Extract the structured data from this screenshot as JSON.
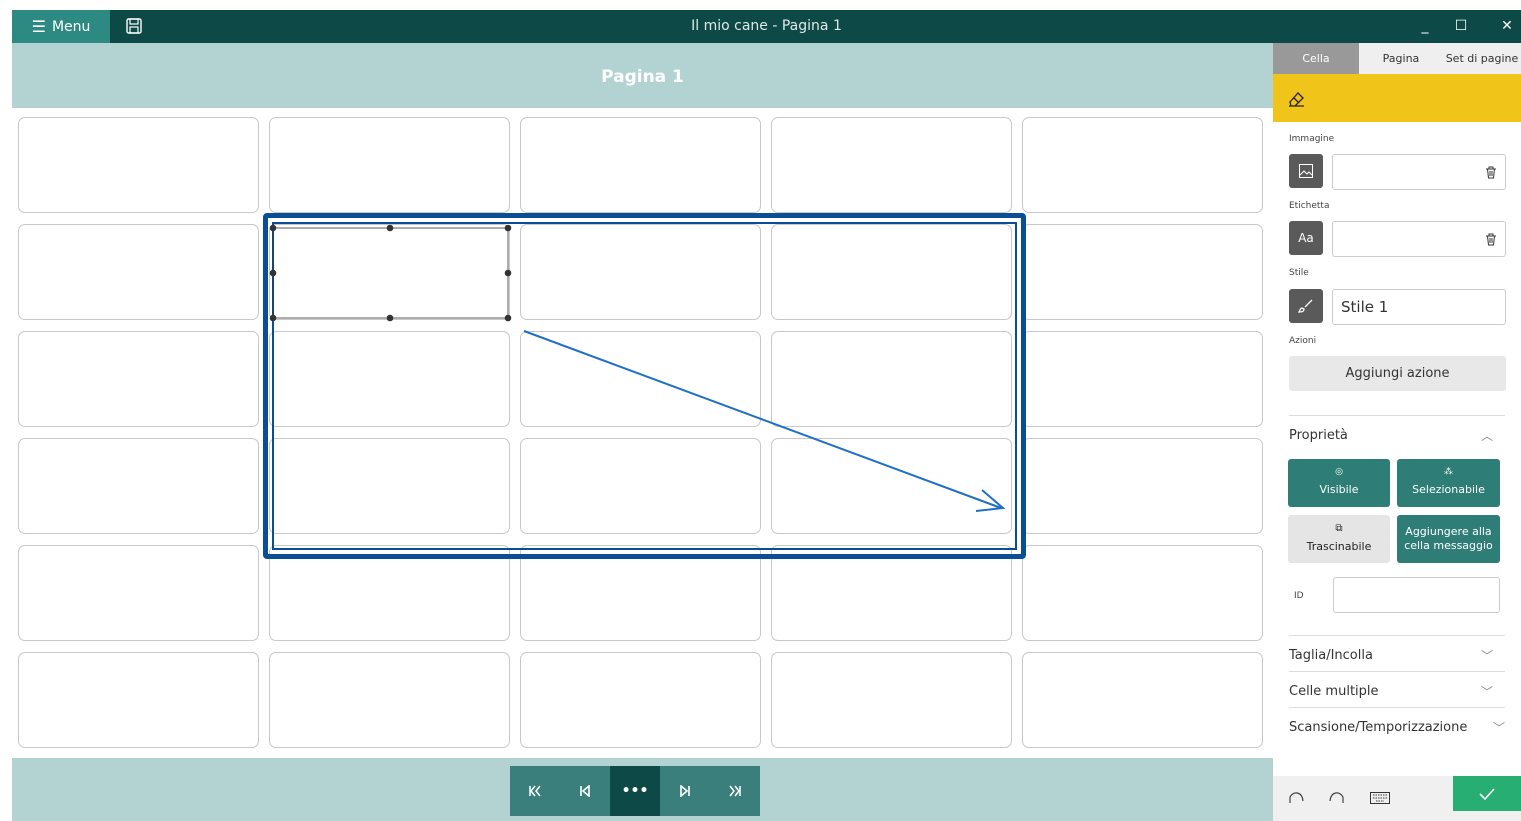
{
  "titlebar": {
    "menu_label": "Menu",
    "window_title": "Il mio cane - Pagina 1",
    "minimize_glyph": "_",
    "maximize_glyph": "☐",
    "close_glyph": "✕"
  },
  "page": {
    "title": "Pagina 1"
  },
  "grid": {
    "rows": 6,
    "cols": 5
  },
  "panel": {
    "tabs": [
      "Cella",
      "Pagina",
      "Set di pagine"
    ],
    "image_label": "Immagine",
    "label_label": "Etichetta",
    "label_icon_text": "Aa",
    "style_label": "Stile",
    "style_value": "Stile 1",
    "actions_label": "Azioni",
    "add_action": "Aggiungi azione",
    "properties_label": "Proprietà",
    "tiles": {
      "visible": "Visibile",
      "selectable": "Selezionabile",
      "draggable": "Trascinabile",
      "add_message": "Aggiungere alla cella messaggio"
    },
    "id_label": "ID",
    "sections": [
      "Taglia/Incolla",
      "Celle multiple",
      "Scansione/Temporizzazione"
    ]
  },
  "colors": {
    "titlebar": "#0d4a47",
    "accent": "#2f7d77",
    "header": "#b3d3d2",
    "yellow": "#f0c419",
    "selection": "#0a4f96",
    "confirm": "#27ae72"
  },
  "icons": {
    "menu": "hamburger-icon",
    "save": "save-icon",
    "eraser": "eraser-icon",
    "image": "image-icon",
    "trash": "trash-icon",
    "brush": "brush-icon",
    "eye": "eye-icon",
    "pointer": "selectable-icon",
    "drag": "drag-icon",
    "undo": "undo-icon",
    "redo": "redo-icon",
    "keyboard": "keyboard-icon",
    "check": "check-icon"
  }
}
